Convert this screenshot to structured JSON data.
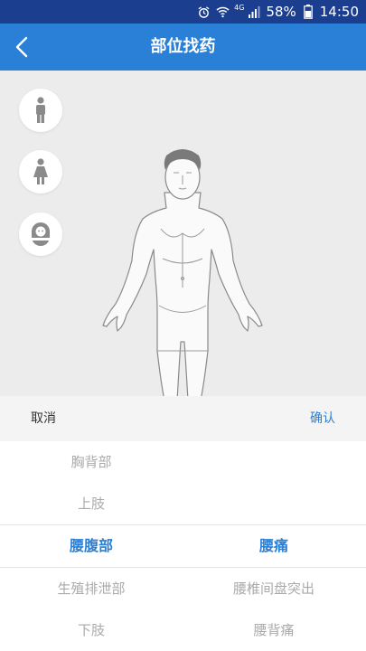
{
  "status_bar": {
    "network": "4G",
    "battery": "58%",
    "time": "14:50"
  },
  "header": {
    "title": "部位找药"
  },
  "body_types": [
    {
      "icon": "adult-male-icon"
    },
    {
      "icon": "adult-female-icon"
    },
    {
      "icon": "baby-icon"
    }
  ],
  "picker": {
    "cancel_label": "取消",
    "confirm_label": "确认",
    "parts": [
      "胸背部",
      "上肢",
      "腰腹部",
      "生殖排泄部",
      "下肢"
    ],
    "selected_part": "腰腹部",
    "symptoms": [
      "腰痛",
      "腰椎间盘突出",
      "腰背痛"
    ],
    "selected_symptom": "腰痛"
  },
  "colors": {
    "status_bar": "#1b3f8e",
    "app_bar": "#2a7fd6",
    "accent": "#2a7fd6"
  }
}
